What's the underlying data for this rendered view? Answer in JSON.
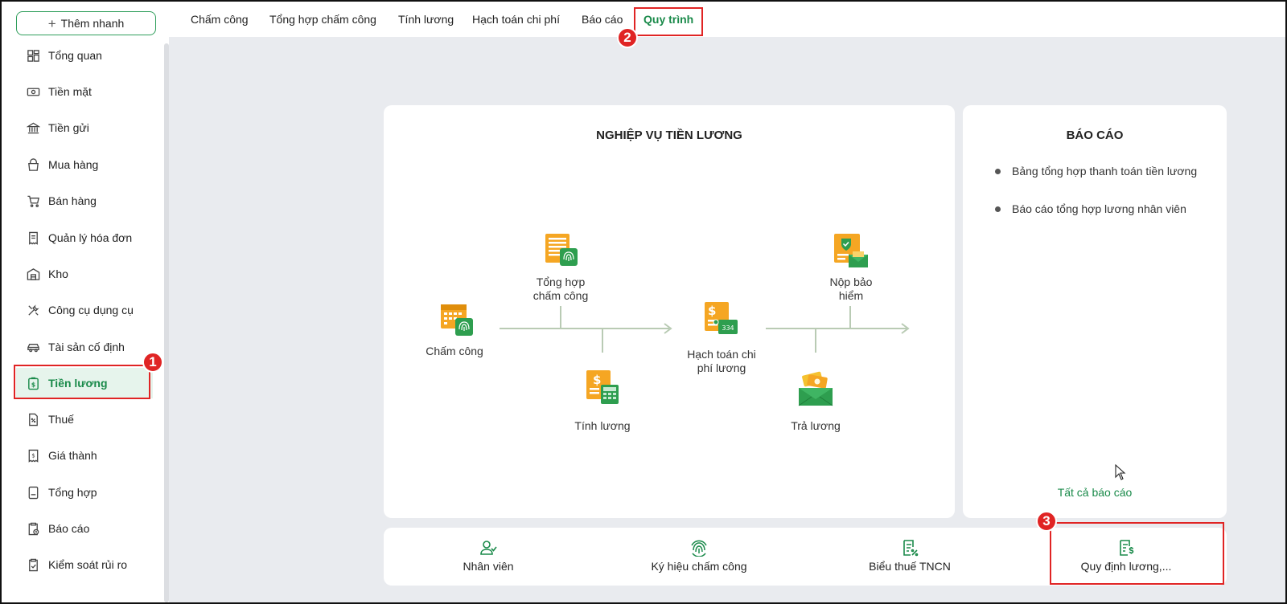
{
  "sidebar": {
    "quick_add": "Thêm nhanh",
    "items": [
      {
        "label": "Tổng quan",
        "icon": "dashboard-icon"
      },
      {
        "label": "Tiền mặt",
        "icon": "cash-icon"
      },
      {
        "label": "Tiền gửi",
        "icon": "bank-icon"
      },
      {
        "label": "Mua hàng",
        "icon": "shopping-bag-icon"
      },
      {
        "label": "Bán hàng",
        "icon": "cart-icon"
      },
      {
        "label": "Quản lý hóa đơn",
        "icon": "invoice-icon"
      },
      {
        "label": "Kho",
        "icon": "warehouse-icon"
      },
      {
        "label": "Công cụ dụng cụ",
        "icon": "tools-icon"
      },
      {
        "label": "Tài sản cố định",
        "icon": "car-icon"
      },
      {
        "label": "Tiền lương",
        "icon": "payroll-icon"
      },
      {
        "label": "Thuế",
        "icon": "tax-icon"
      },
      {
        "label": "Giá thành",
        "icon": "cost-icon"
      },
      {
        "label": "Tổng hợp",
        "icon": "summary-icon"
      },
      {
        "label": "Báo cáo",
        "icon": "report-icon"
      },
      {
        "label": "Kiểm soát rủi ro",
        "icon": "risk-control-icon"
      }
    ],
    "active_index": 9
  },
  "tabs": [
    {
      "label": "Chấm công"
    },
    {
      "label": "Tổng hợp chấm công"
    },
    {
      "label": "Tính lương"
    },
    {
      "label": "Hạch toán chi phí"
    },
    {
      "label": "Báo cáo"
    },
    {
      "label": "Quy trình"
    }
  ],
  "active_tab": "Quy trình",
  "workflow": {
    "title": "NGHIỆP VỤ TIỀN LƯƠNG",
    "steps": {
      "cham_cong": "Chấm công",
      "tong_hop_1": "Tổng hợp",
      "tong_hop_2": "chấm công",
      "tinh_luong": "Tính lương",
      "hach_toan_1": "Hạch toán chi",
      "hach_toan_2": "phí lương",
      "nop_bh_1": "Nộp bảo",
      "nop_bh_2": "hiểm",
      "tra_luong": "Trả lương"
    },
    "voucher_code": "334"
  },
  "reports": {
    "title": "BÁO CÁO",
    "items": [
      "Bảng tổng hợp thanh toán tiền lương",
      "Báo cáo tổng hợp lương nhân viên"
    ],
    "all_link": "Tất cả báo cáo"
  },
  "shortcuts": [
    {
      "label": "Nhân viên",
      "icon": "employee-icon"
    },
    {
      "label": "Ký hiệu chấm công",
      "icon": "fingerprint-icon"
    },
    {
      "label": "Biểu thuế TNCN",
      "icon": "tax-table-icon"
    },
    {
      "label": "Quy định lương,...",
      "icon": "salary-rule-icon"
    }
  ],
  "annotations": [
    "1",
    "2",
    "3"
  ],
  "colors": {
    "brand_green": "#1a8a4a",
    "highlight_red": "#e02424",
    "icon_orange": "#f5a623",
    "icon_green": "#2e9e4f",
    "background": "#e9ebef"
  }
}
